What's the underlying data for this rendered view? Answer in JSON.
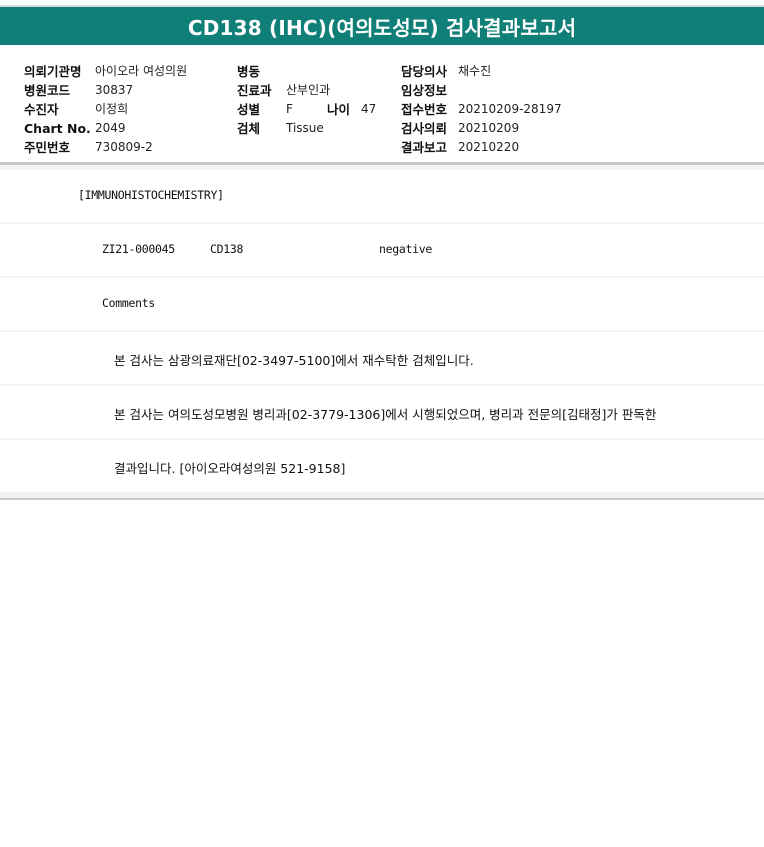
{
  "title": "CD138 (IHC)(여의도성모) 검사결과보고서",
  "info": {
    "institution_label": "의뢰기관명",
    "institution": "아이오라 여성의원",
    "ward_label": "병동",
    "ward": "",
    "doctor_label": "담당의사",
    "doctor": "채수진",
    "hospital_code_label": "병원코드",
    "hospital_code": "30837",
    "department_label": "진료과",
    "department": "산부인과",
    "clinical_info_label": "임상정보",
    "clinical_info": "",
    "patient_label": "수진자",
    "patient": "이정희",
    "sex_label": "성별",
    "sex": "F",
    "age_label": "나이",
    "age": "47",
    "receipt_no_label": "접수번호",
    "receipt_no": "20210209-28197",
    "chart_no_label": "Chart No.",
    "chart_no": "2049",
    "specimen_label": "검체",
    "specimen": "Tissue",
    "request_date_label": "검사의뢰",
    "request_date": "20210209",
    "id_no_label": "주민번호",
    "id_no": "730809-2",
    "report_date_label": "결과보고",
    "report_date": "20210220"
  },
  "results": {
    "section": "[IMMUNOHISTOCHEMISTRY]",
    "case_no": "ZI21-000045",
    "marker": "CD138",
    "result": "negative",
    "comments_label": "Comments",
    "comment_1": "본 검사는 삼광의료재단[02-3497-5100]에서 재수탁한 검체입니다.",
    "comment_2": "본 검사는 여의도성모병원 병리과[02-3779-1306]에서 시행되었으며, 병리과 전문의[김태정]가 판독한",
    "comment_3": "결과입니다. [아이오라여성의원 521-9158]"
  }
}
